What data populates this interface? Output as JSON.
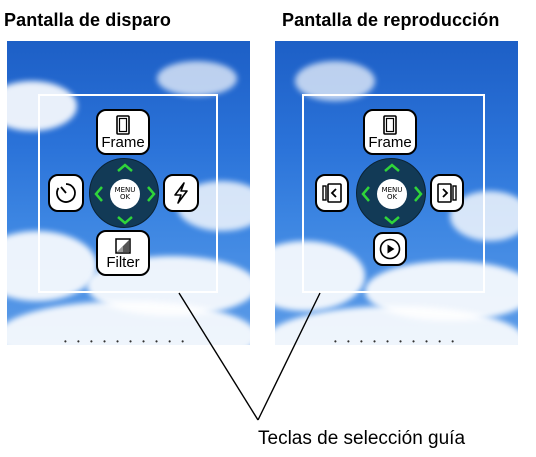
{
  "panels": {
    "shooting": {
      "title": "Pantalla de disparo",
      "keys": {
        "frame": "Frame",
        "filter": "Filter",
        "menu_top": "MENU",
        "menu_bottom": "OK",
        "left_icon": "self-timer-icon",
        "right_icon": "flash-icon"
      }
    },
    "playback": {
      "title": "Pantalla de reproducción",
      "keys": {
        "frame": "Frame",
        "menu_top": "MENU",
        "menu_bottom": "OK",
        "left_icon": "previous-image-icon",
        "right_icon": "next-image-icon",
        "bottom_icon": "play-icon"
      }
    }
  },
  "page_indicator": "• • • • • • • • • •",
  "caption": "Teclas de selección guía",
  "colors": {
    "sky": "#2b73d9",
    "ring": "#123a56",
    "arrow": "#2fd53a"
  }
}
